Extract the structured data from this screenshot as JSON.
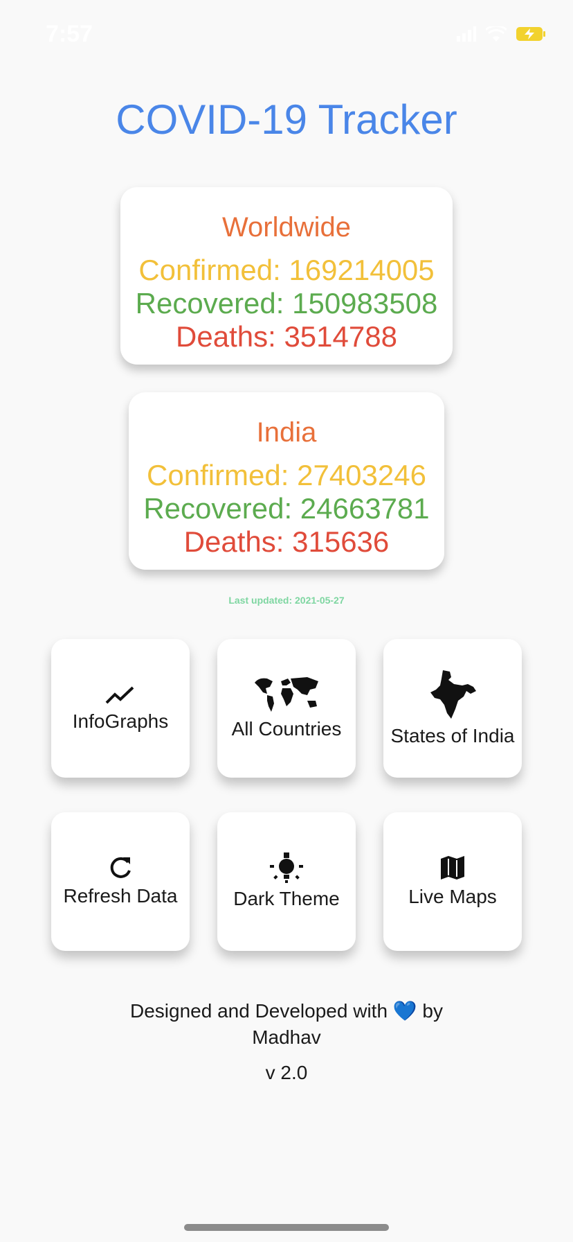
{
  "status_bar": {
    "time": "7:57"
  },
  "app": {
    "title": "COVID-19 Tracker"
  },
  "worldwide": {
    "region": "Worldwide",
    "confirmed": "Confirmed: 169214005",
    "recovered": "Recovered: 150983508",
    "deaths": "Deaths: 3514788"
  },
  "india": {
    "region": "India",
    "confirmed": "Confirmed: 27403246",
    "recovered": "Recovered: 24663781",
    "deaths": "Deaths: 315636"
  },
  "last_updated": "Last updated: 2021-05-27",
  "tiles": [
    {
      "label": "InfoGraphs",
      "icon": "trending-chart-icon"
    },
    {
      "label": "All Countries",
      "icon": "world-map-icon"
    },
    {
      "label": "States of India",
      "icon": "india-map-icon"
    },
    {
      "label": "Refresh Data",
      "icon": "refresh-icon"
    },
    {
      "label": "Dark Theme",
      "icon": "lightbulb-icon"
    },
    {
      "label": "Live Maps",
      "icon": "map-icon"
    }
  ],
  "footer": {
    "text": "Designed and Developed with 💙 by Madhav",
    "version": "v 2.0"
  },
  "colors": {
    "title": "#4a86e8",
    "region": "#e8703a",
    "confirmed": "#f2c03a",
    "recovered": "#5cab4f",
    "deaths": "#e04b3a",
    "last_updated": "#7ed6a1"
  }
}
